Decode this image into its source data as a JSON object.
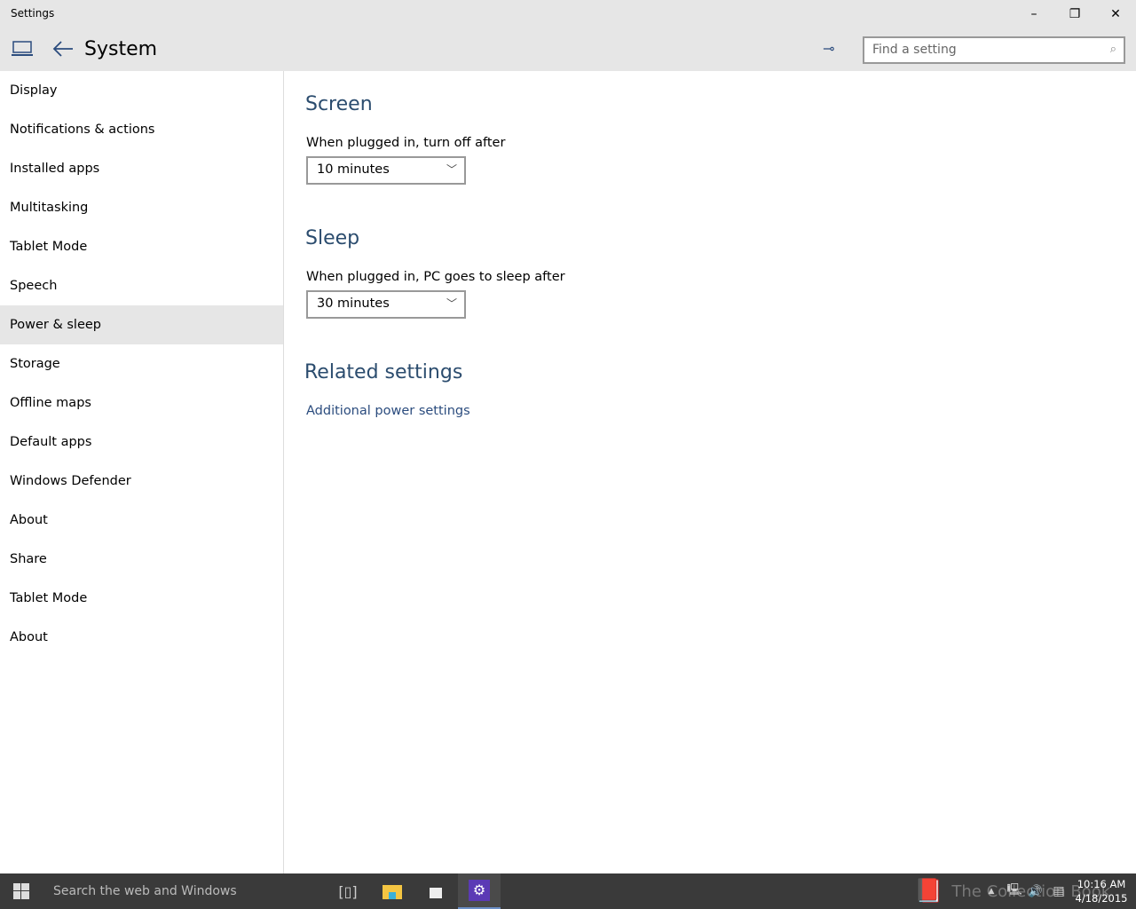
{
  "window": {
    "title": "Settings",
    "minimize": "–",
    "restore": "❐",
    "close": "✕"
  },
  "header": {
    "title": "System",
    "search_placeholder": "Find a setting",
    "device_icon": "laptop-icon",
    "back_icon": "arrow-left-icon",
    "pin_icon": "pin-icon"
  },
  "sidebar": {
    "items": [
      {
        "label": "Display"
      },
      {
        "label": "Notifications & actions"
      },
      {
        "label": "Installed apps"
      },
      {
        "label": "Multitasking"
      },
      {
        "label": "Tablet Mode"
      },
      {
        "label": "Speech"
      },
      {
        "label": "Power & sleep",
        "selected": true
      },
      {
        "label": "Storage"
      },
      {
        "label": "Offline maps"
      },
      {
        "label": "Default apps"
      },
      {
        "label": "Windows Defender"
      },
      {
        "label": "About"
      },
      {
        "label": "Share"
      },
      {
        "label": "Tablet Mode"
      },
      {
        "label": "About"
      }
    ]
  },
  "main": {
    "screen": {
      "heading": "Screen",
      "label": "When plugged in, turn off after",
      "value": "10 minutes"
    },
    "sleep": {
      "heading": "Sleep",
      "label": "When plugged in, PC goes to sleep after",
      "value": "30 minutes"
    },
    "related": {
      "heading": "Related settings",
      "link": "Additional power settings"
    }
  },
  "taskbar": {
    "search_placeholder": "Search the web and Windows",
    "time": "10:16 AM",
    "date": "4/18/2015",
    "watermark": "The Collection Book"
  },
  "colors": {
    "accent": "#2b4c6e",
    "taskbar": "#3a3a3a",
    "settings_app": "#5b3ab5"
  }
}
